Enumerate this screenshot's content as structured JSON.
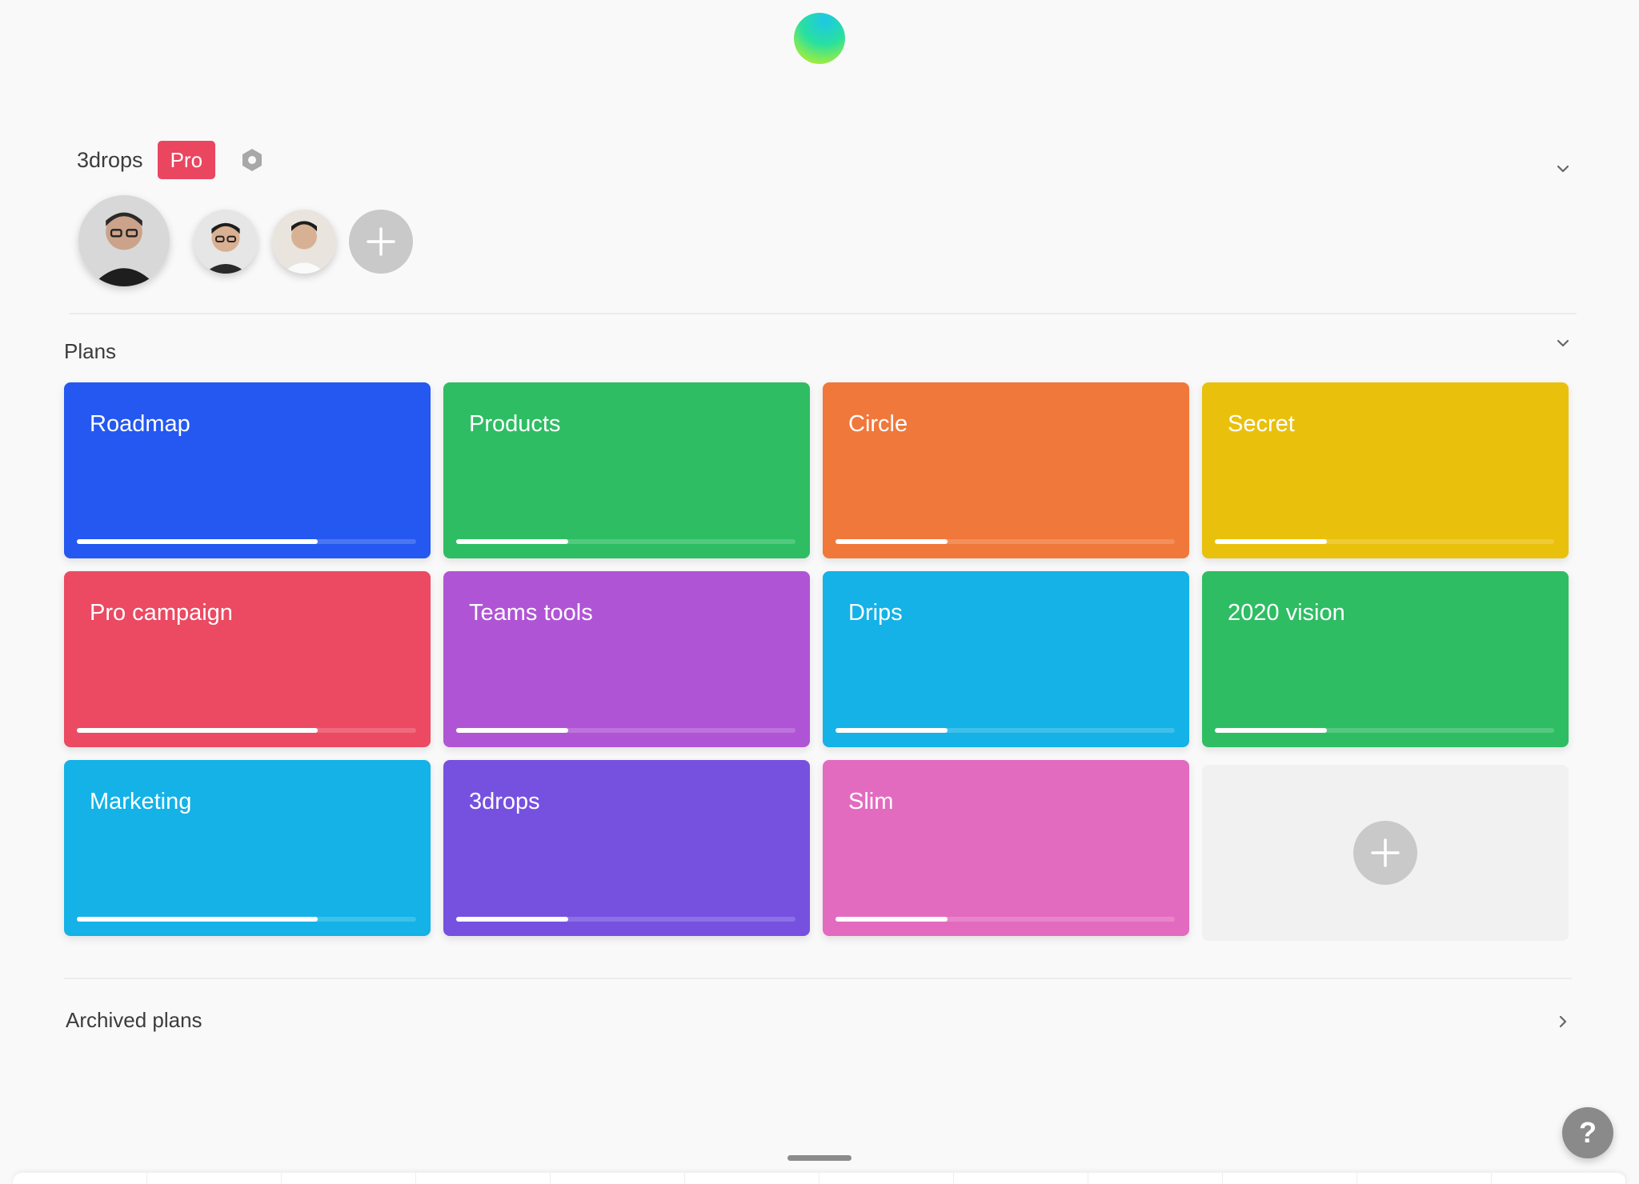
{
  "app": {
    "logo_icon": "gradient-orb-logo"
  },
  "team": {
    "name": "3drops",
    "badge": "Pro",
    "settings_icon": "hexagon-settings-icon",
    "members": [
      {
        "avatar": "member-avatar-1"
      },
      {
        "avatar": "member-avatar-2"
      },
      {
        "avatar": "member-avatar-3"
      }
    ],
    "add_member_icon": "plus-icon"
  },
  "plans": {
    "title": "Plans",
    "items": [
      {
        "name": "Roadmap",
        "color": "#2458f0",
        "progress": 0.71
      },
      {
        "name": "Products",
        "color": "#2ebd63",
        "progress": 0.33
      },
      {
        "name": "Circle",
        "color": "#f0783a",
        "progress": 0.33
      },
      {
        "name": "Secret",
        "color": "#e9c10c",
        "progress": 0.33
      },
      {
        "name": "Pro campaign",
        "color": "#eb4a62",
        "progress": 0.71
      },
      {
        "name": "Teams tools",
        "color": "#b054d6",
        "progress": 0.33
      },
      {
        "name": "Drips",
        "color": "#14b2e6",
        "progress": 0.33
      },
      {
        "name": "2020 vision",
        "color": "#2ebd63",
        "progress": 0.33
      },
      {
        "name": "Marketing",
        "color": "#14b2e6",
        "progress": 0.71
      },
      {
        "name": "3drops",
        "color": "#7651e0",
        "progress": 0.33
      },
      {
        "name": "Slim",
        "color": "#e36bbf",
        "progress": 0.33
      }
    ],
    "add_plan_icon": "plus-icon"
  },
  "archived": {
    "label": "Archived plans"
  },
  "help": {
    "label": "?"
  },
  "colors": {
    "badge": "#ea4660",
    "add_button": "#c9c9c9",
    "help_button": "#8a8a8a"
  }
}
